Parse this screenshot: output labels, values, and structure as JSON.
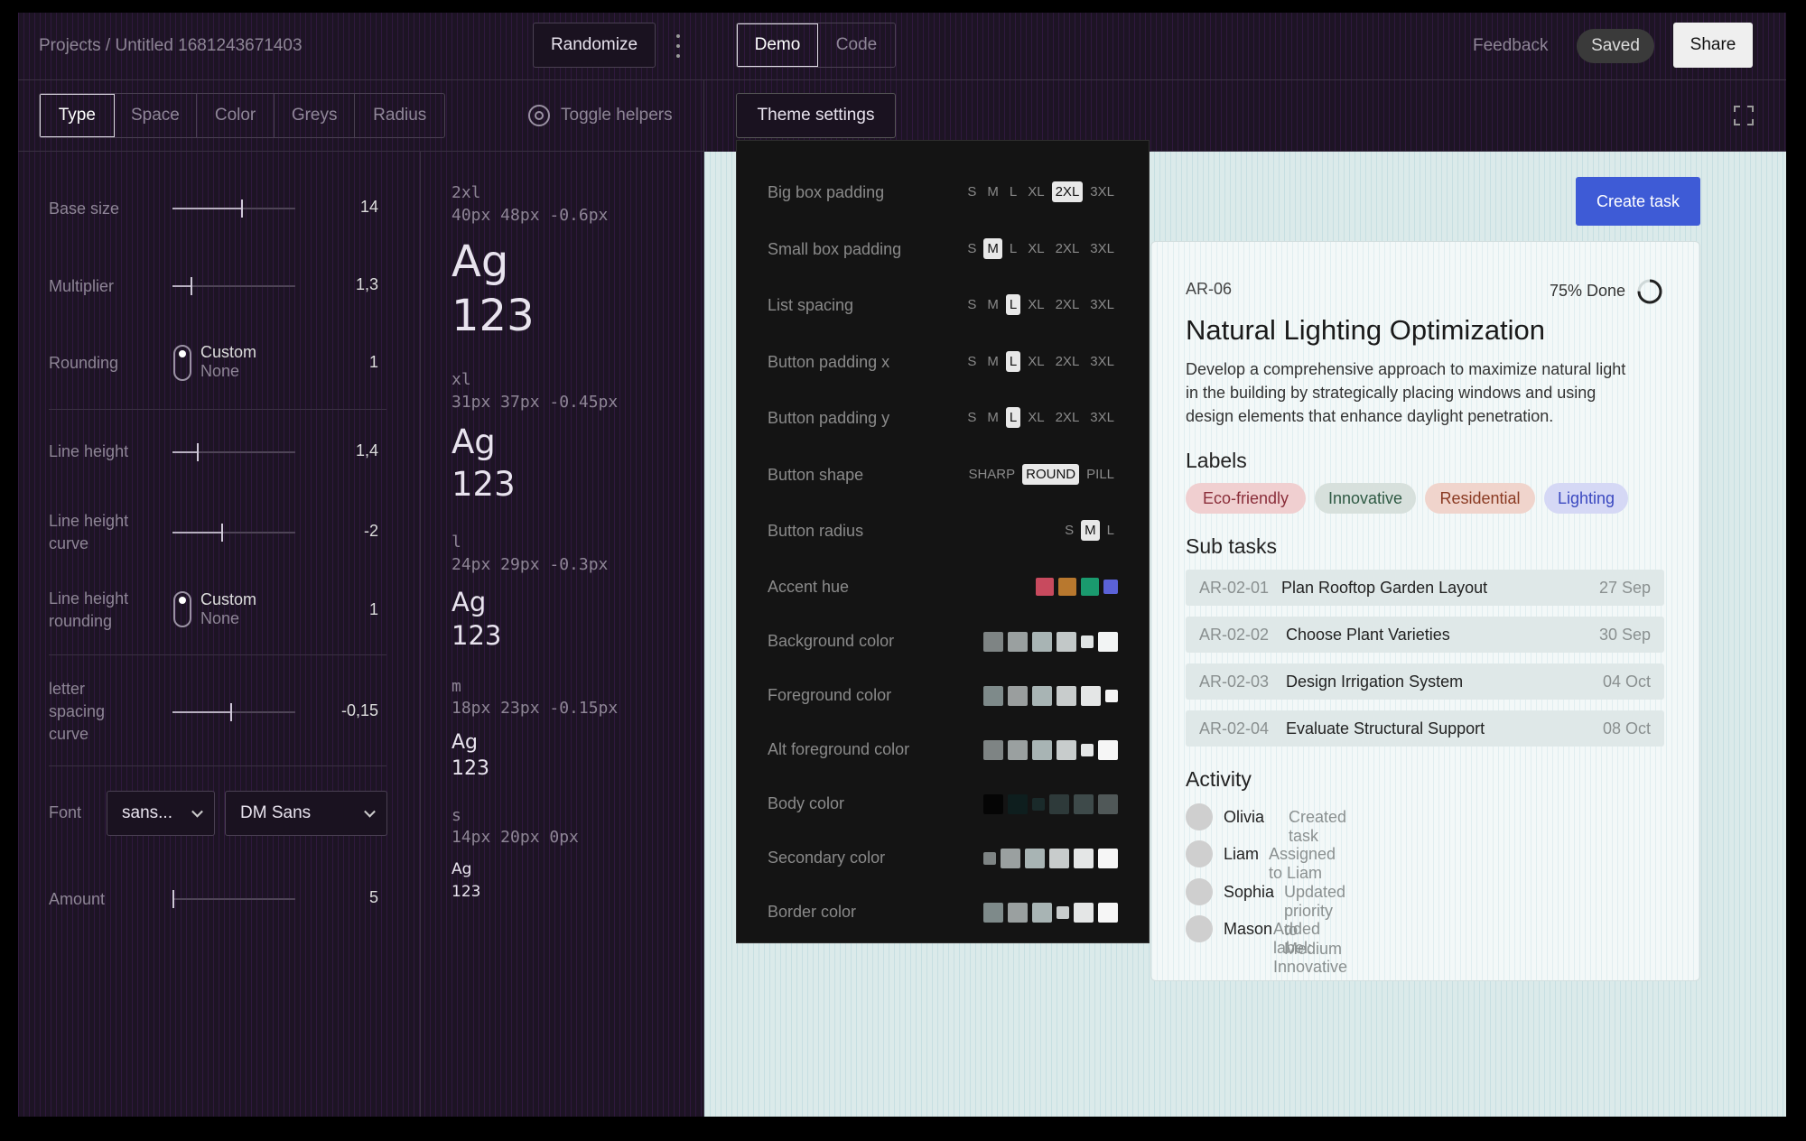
{
  "header": {
    "breadcrumb": "Projects / Untitled 1681243671403",
    "randomize": "Randomize",
    "demo": "Demo",
    "code": "Code",
    "feedback": "Feedback",
    "saved": "Saved",
    "share": "Share"
  },
  "tabs": [
    "Type",
    "Space",
    "Color",
    "Greys",
    "Radius"
  ],
  "toggle_helpers": "Toggle helpers",
  "theme_settings": "Theme settings",
  "controls": {
    "base_size": {
      "label": "Base size",
      "value": "14",
      "fraction": 0.56
    },
    "multiplier": {
      "label": "Multiplier",
      "value": "1,3",
      "fraction": 0.15
    },
    "rounding": {
      "label": "Rounding",
      "opt1": "Custom",
      "opt2": "None",
      "value": "1"
    },
    "line_height": {
      "label": "Line height",
      "value": "1,4",
      "fraction": 0.2
    },
    "line_height_curve": {
      "label1": "Line height",
      "label2": "curve",
      "value": "-2",
      "fraction": 0.4
    },
    "line_height_rounding": {
      "label1": "Line height",
      "label2": "rounding",
      "opt1": "Custom",
      "opt2": "None",
      "value": "1"
    },
    "letter_spacing": {
      "label1": "letter",
      "label2": "spacing",
      "label3": "curve",
      "value": "-0,15",
      "fraction": 0.47
    },
    "font": {
      "label": "Font",
      "family": "sans...",
      "name": "DM Sans"
    },
    "amount": {
      "label": "Amount",
      "value": "5",
      "fraction": 0.0
    }
  },
  "scale": [
    {
      "name": "2xl",
      "spec": "40px 48px -0.6px",
      "ag": "Ag",
      "num": "123"
    },
    {
      "name": "xl",
      "spec": "31px 37px -0.45px",
      "ag": "Ag",
      "num": "123"
    },
    {
      "name": "l",
      "spec": "24px 29px -0.3px",
      "ag": "Ag",
      "num": "123"
    },
    {
      "name": "m",
      "spec": "18px 23px -0.15px",
      "ag": "Ag",
      "num": "123"
    },
    {
      "name": "s",
      "spec": "14px 20px 0px",
      "ag": "Ag",
      "num": "123"
    }
  ],
  "theme": {
    "big_box_padding": "Big box padding",
    "small_box_padding": "Small box padding",
    "list_spacing": "List spacing",
    "button_padding_x": "Button padding x",
    "button_padding_y": "Button padding y",
    "button_shape": "Button shape",
    "button_radius": "Button radius",
    "accent_hue": "Accent hue",
    "background_color": "Background color",
    "foreground_color": "Foreground color",
    "alt_foreground_color": "Alt foreground color",
    "body_color": "Body color",
    "secondary_color": "Secondary color",
    "border_color": "Border color",
    "sizes": [
      "S",
      "M",
      "L",
      "XL",
      "2XL",
      "3XL"
    ],
    "shapes": [
      "SHARP",
      "ROUND",
      "PILL"
    ],
    "radius": [
      "S",
      "M",
      "L"
    ]
  },
  "colors": {
    "accent": "#3e5bd6",
    "tag_eco": "#f0cfd0",
    "tag_innov": "#d7e0dc",
    "tag_res": "#f0d4cc",
    "tag_light": "#d5d8f5"
  },
  "card": {
    "create_task": "Create task",
    "id": "AR-06",
    "done": "75% Done",
    "done_fraction": 0.75,
    "title": "Natural Lighting Optimization",
    "desc1": "Develop a comprehensive approach to maximize natural light",
    "desc2": "in the building by strategically placing windows and using",
    "desc3": "design elements that enhance daylight penetration.",
    "labels_title": "Labels",
    "labels": [
      "Eco-friendly",
      "Innovative",
      "Residential",
      "Lighting"
    ],
    "subtasks_title": "Sub tasks",
    "subtasks": [
      {
        "id": "AR-02-01",
        "name": "Plan Rooftop Garden Layout",
        "date": "27 Sep"
      },
      {
        "id": "AR-02-02",
        "name": "Choose Plant Varieties",
        "date": "30 Sep"
      },
      {
        "id": "AR-02-03",
        "name": "Design Irrigation System",
        "date": "04 Oct"
      },
      {
        "id": "AR-02-04",
        "name": "Evaluate Structural Support",
        "date": "08 Oct"
      }
    ],
    "activity_title": "Activity",
    "activity": [
      {
        "who": "Olivia",
        "what": "Created task"
      },
      {
        "who": "Liam",
        "what": "Assigned to Liam"
      },
      {
        "who": "Sophia",
        "what": "Updated priority to Medium"
      },
      {
        "who": "Mason",
        "what": "Added label: Innovative"
      }
    ]
  }
}
